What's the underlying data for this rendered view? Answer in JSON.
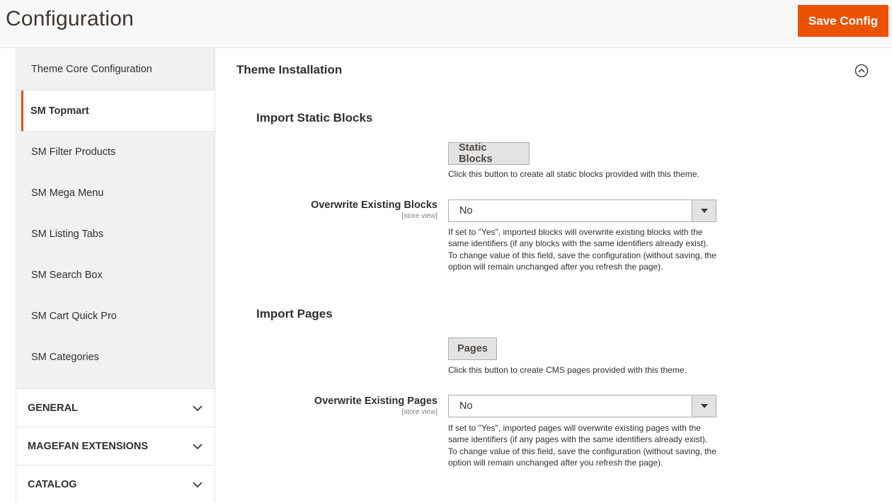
{
  "header": {
    "title": "Configuration",
    "save_label": "Save Config"
  },
  "sidebar": {
    "items": [
      {
        "label": "Theme Core Configuration"
      },
      {
        "label": "SM Topmart"
      },
      {
        "label": "SM Filter Products"
      },
      {
        "label": "SM Mega Menu"
      },
      {
        "label": "SM Listing Tabs"
      },
      {
        "label": "SM Search Box"
      },
      {
        "label": "SM Cart Quick Pro"
      },
      {
        "label": "SM Categories"
      }
    ],
    "sections": [
      {
        "label": "GENERAL"
      },
      {
        "label": "MAGEFAN EXTENSIONS"
      },
      {
        "label": "CATALOG"
      }
    ]
  },
  "main": {
    "fieldset_title": "Theme Installation",
    "blocks": {
      "title": "Import Static Blocks",
      "button_label": "Static Blocks",
      "button_note": "Click this button to create all static blocks provided with this theme.",
      "field_label": "Overwrite Existing Blocks",
      "scope": "[store view]",
      "value": "No",
      "note": "If set to \"Yes\", imported blocks will overwrite existing blocks with the same identifiers (if any blocks with the same identifiers already exist). To change value of this field, save the configuration (without saving, the option will remain unchanged after you refresh the page)."
    },
    "pages": {
      "title": "Import Pages",
      "button_label": "Pages",
      "button_note": "Click this button to create CMS pages provided with this theme.",
      "field_label": "Overwrite Existing Pages",
      "scope": "[store view]",
      "value": "No",
      "note": "If set to \"Yes\", imported pages will overwrite existing pages with the same identifiers (if any pages with the same identifiers already exist). To change value of this field, save the configuration (without saving, the option will remain unchanged after you refresh the page)."
    }
  },
  "colors": {
    "accent": "#eb5202",
    "sidebar_bg": "#f1f1f1",
    "header_bg": "#f8f8f8"
  }
}
